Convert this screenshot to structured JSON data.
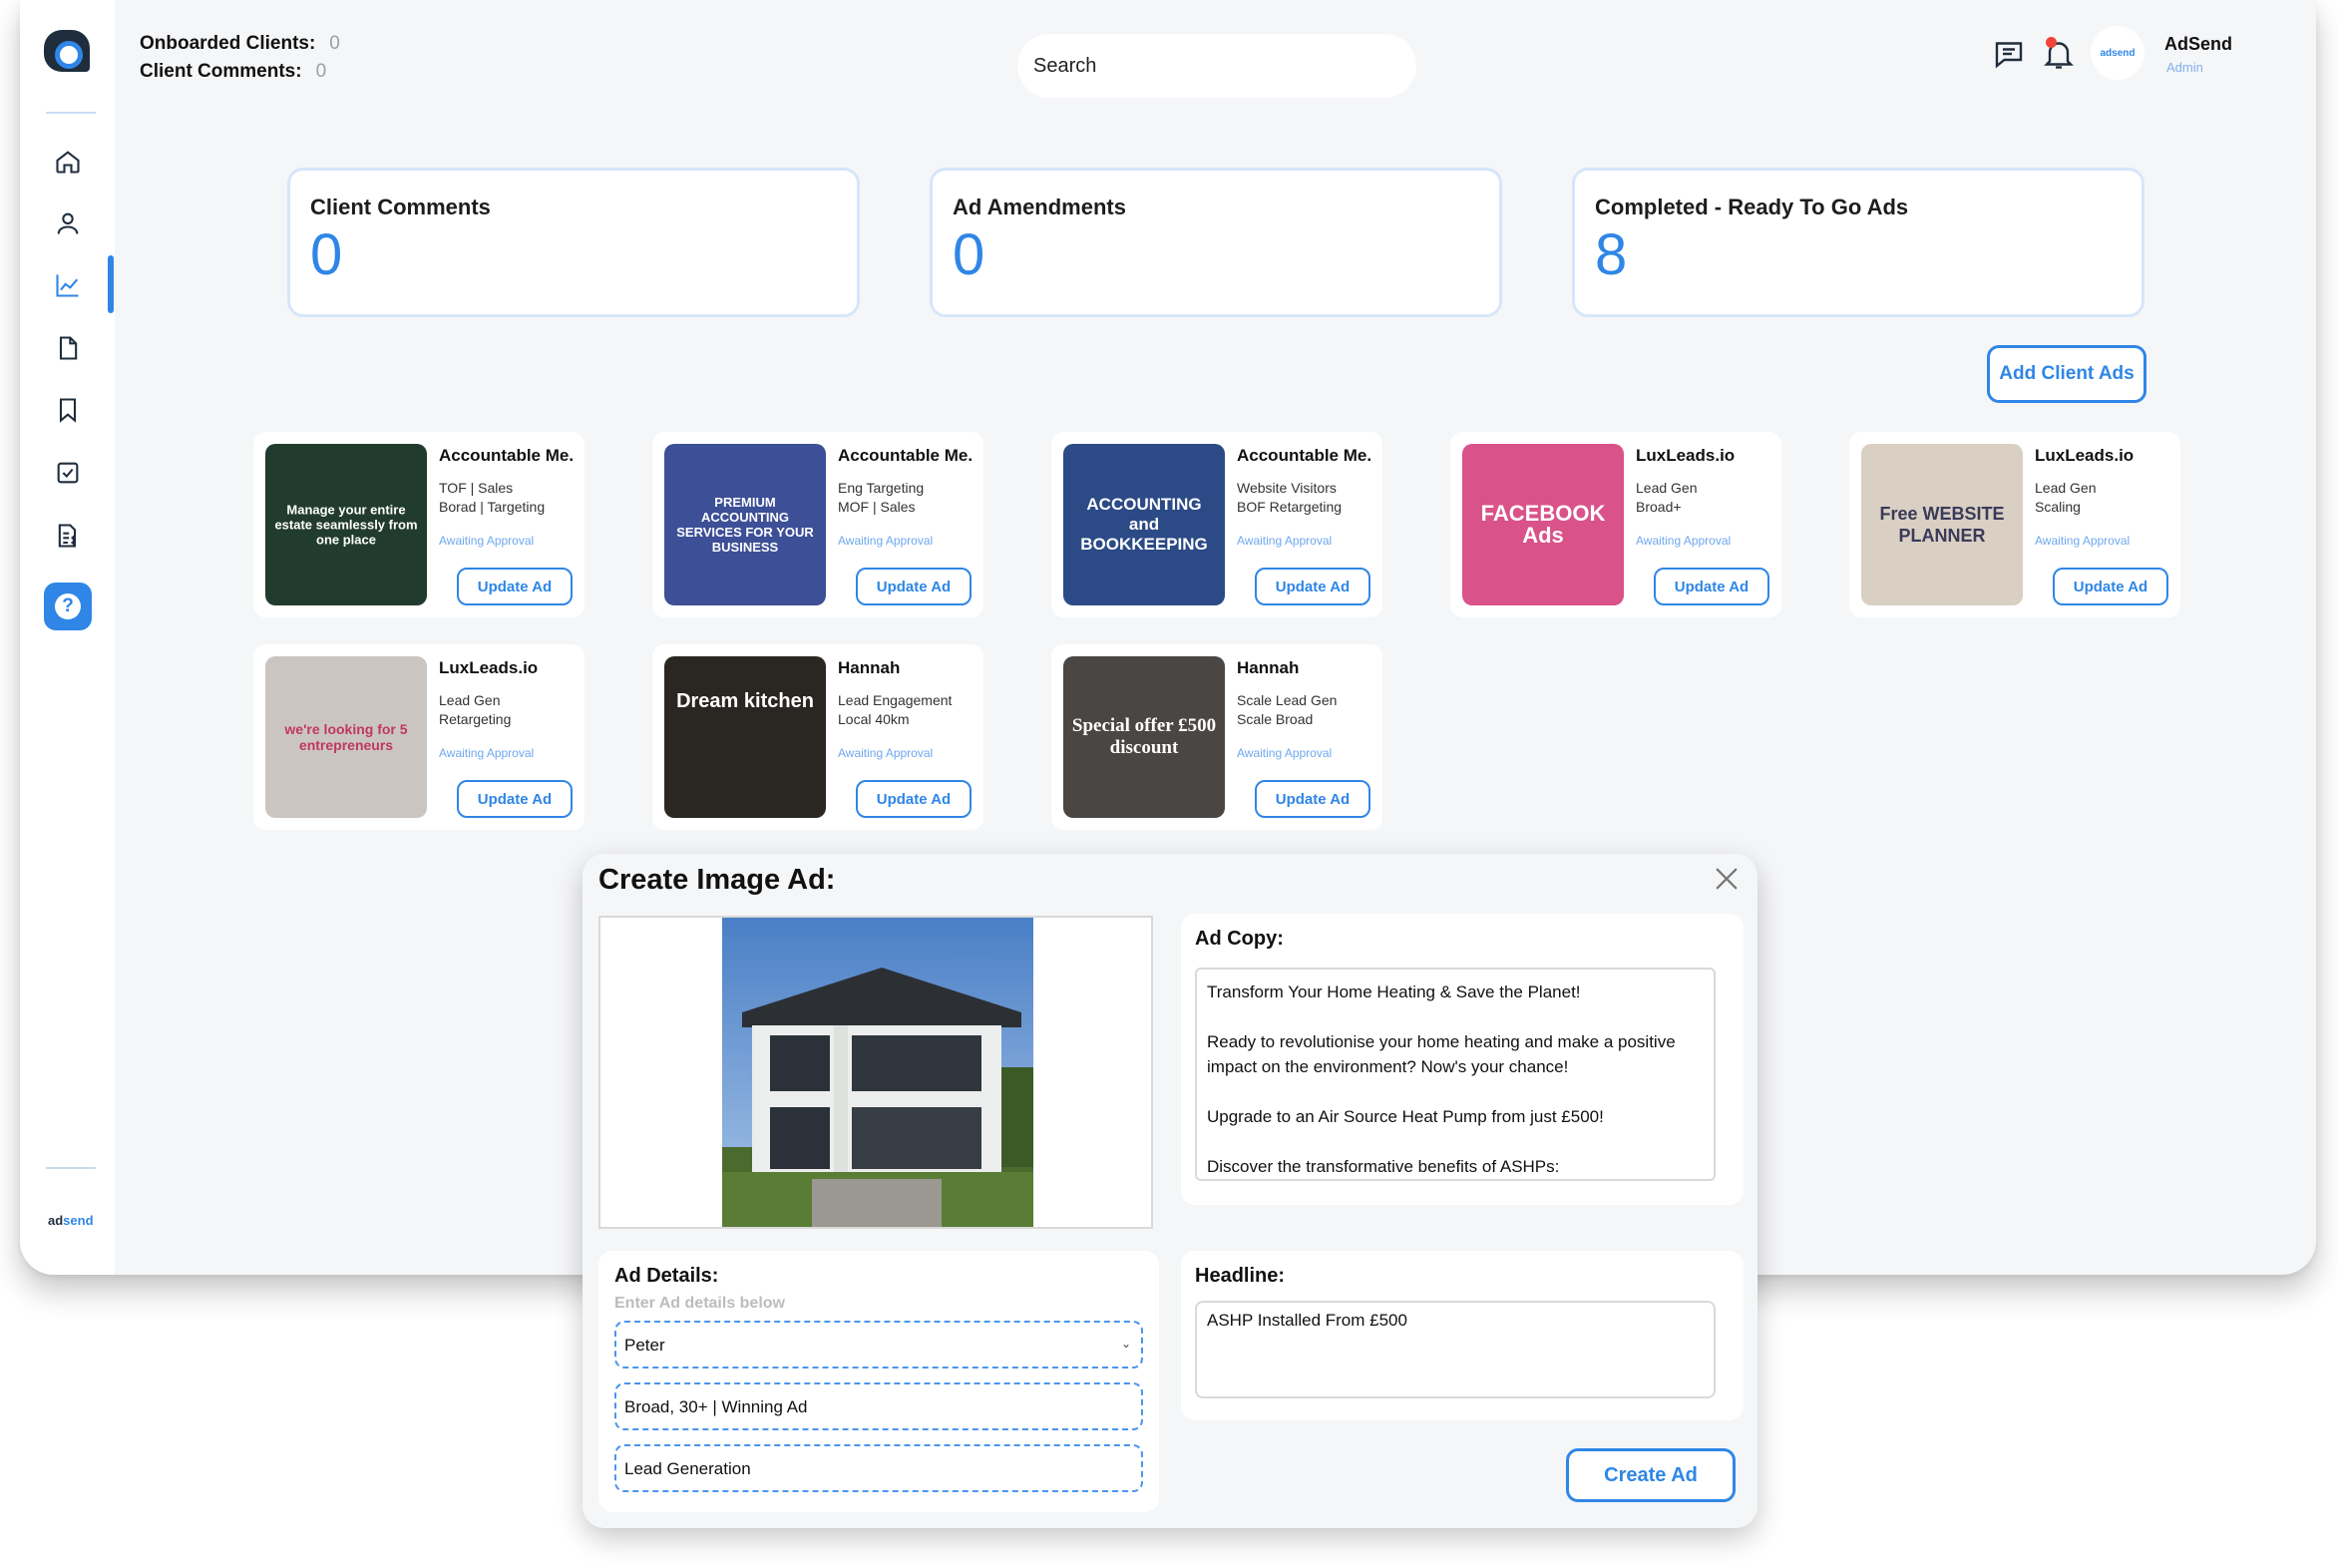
{
  "header": {
    "onboarded_label": "Onboarded Clients:",
    "onboarded_value": "0",
    "comments_label": "Client Comments:",
    "comments_value": "0",
    "search_placeholder": "Search",
    "user_name": "AdSend",
    "user_role": "Admin",
    "avatar_text": "adsend"
  },
  "sidebar": {
    "icons": [
      "home-icon",
      "user-icon",
      "analytics-icon",
      "document-icon",
      "bookmark-icon",
      "checkbox-icon",
      "invoice-icon",
      "help-icon"
    ],
    "active": "analytics-icon",
    "brand_prefix": "ad",
    "brand_suffix": "send"
  },
  "stats": [
    {
      "title": "Client Comments",
      "value": "0"
    },
    {
      "title": "Ad Amendments",
      "value": "0"
    },
    {
      "title": "Completed - Ready To Go Ads",
      "value": "8"
    }
  ],
  "add_client_ads_label": "Add Client Ads",
  "ads": [
    {
      "client": "Accountable Me.",
      "line1": "TOF | Sales",
      "line2": "Borad | Targeting",
      "status": "Awaiting Approval",
      "button": "Update Ad",
      "thumb_color": "#223b2f",
      "thumb_text": "Manage your entire estate seamlessly from one place"
    },
    {
      "client": "Accountable Me.",
      "line1": "Eng Targeting",
      "line2": "MOF | Sales",
      "status": "Awaiting Approval",
      "button": "Update Ad",
      "thumb_color": "#3d4f96",
      "thumb_text": "PREMIUM ACCOUNTING SERVICES FOR YOUR BUSINESS"
    },
    {
      "client": "Accountable Me.",
      "line1": "Website Visitors",
      "line2": "BOF Retargeting",
      "status": "Awaiting Approval",
      "button": "Update Ad",
      "thumb_color": "#2c4a86",
      "thumb_text": "ACCOUNTING and BOOKKEEPING"
    },
    {
      "client": "LuxLeads.io",
      "line1": "Lead Gen",
      "line2": "Broad+",
      "status": "Awaiting Approval",
      "button": "Update Ad",
      "thumb_color": "#d9528a",
      "thumb_text": "FACEBOOK Ads"
    },
    {
      "client": "LuxLeads.io",
      "line1": "Lead Gen",
      "line2": "Scaling",
      "status": "Awaiting Approval",
      "button": "Update Ad",
      "thumb_color": "#d9cfc2",
      "thumb_text": "Free WEBSITE PLANNER"
    },
    {
      "client": "LuxLeads.io",
      "line1": "Lead Gen",
      "line2": "Retargeting",
      "status": "Awaiting Approval",
      "button": "Update Ad",
      "thumb_color": "#cbc5c2",
      "thumb_text": "we're looking for 5 entrepreneurs"
    },
    {
      "client": "Hannah",
      "line1": "Lead Engagement",
      "line2": "Local 40km",
      "status": "Awaiting Approval",
      "button": "Update Ad",
      "thumb_color": "#2a2622",
      "thumb_text": "Dream kitchen"
    },
    {
      "client": "Hannah",
      "line1": "Scale Lead Gen",
      "line2": "Scale Broad",
      "status": "Awaiting Approval",
      "button": "Update Ad",
      "thumb_color": "#4a4643",
      "thumb_text": "Special offer £500 discount"
    }
  ],
  "modal": {
    "title": "Create Image Ad:",
    "ad_copy_label": "Ad Copy:",
    "ad_copy": [
      "Transform Your Home Heating & Save the Planet!",
      "Ready to revolutionise your home heating and make a positive impact on the environment? Now's your chance!",
      "Upgrade to an Air Source Heat Pump from just £500!",
      "Discover the transformative benefits of ASHPs:"
    ],
    "details_label": "Ad Details:",
    "details_hint": "Enter Ad details below",
    "client_select": "Peter",
    "audience_field": "Broad, 30+ | Winning Ad",
    "objective_field": "Lead Generation",
    "headline_label": "Headline:",
    "headline": "ASHP Installed From £500",
    "create_button": "Create Ad"
  },
  "colors": {
    "accent": "#2f86e6",
    "status_text": "#6ea8ef",
    "notification": "#f04438"
  }
}
